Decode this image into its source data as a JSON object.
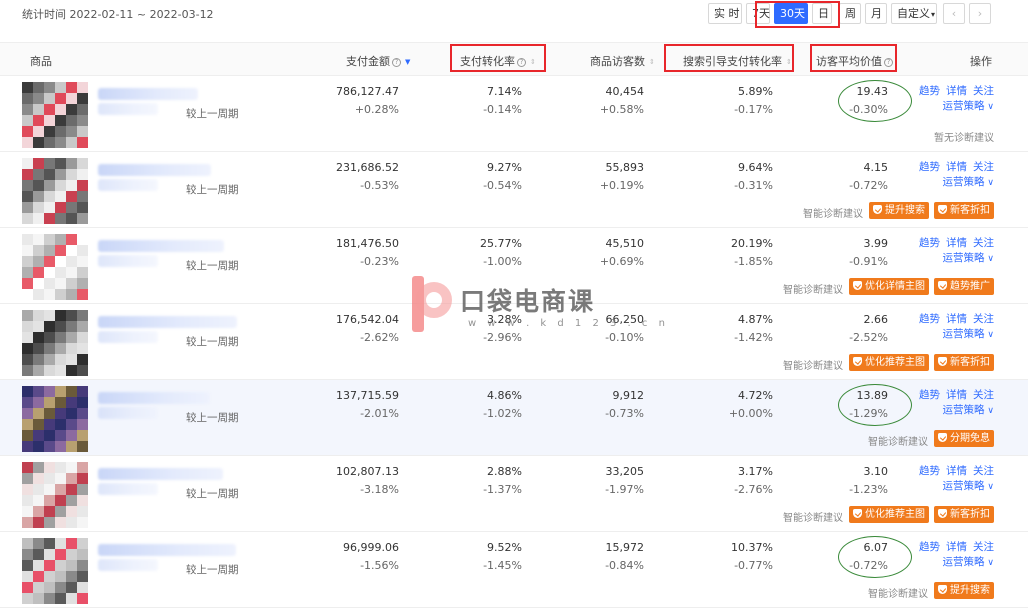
{
  "top": {
    "stat_time": "统计时间 2022-02-11 ~ 2022-03-12",
    "periods": [
      "实 时",
      "7天",
      "30天",
      "日",
      "周",
      "月",
      "自定义"
    ],
    "active_period": "30天",
    "custom_dropdown_icon": "chevron-down-icon",
    "prev_icon": "chevron-left-icon",
    "next_icon": "chevron-right-icon"
  },
  "columns": {
    "product": "商品",
    "pay_amount": "支付金额",
    "pay_conversion": "支付转化率",
    "visitors": "商品访客数",
    "search_conversion": "搜索引导支付转化率",
    "visitor_value": "访客平均价值",
    "action": "操作"
  },
  "labels": {
    "compare": "较上一周期",
    "trend": "趋势",
    "detail": "详情",
    "follow": "关注",
    "strategy": "运营策略",
    "smart_diag": "智能诊断建议",
    "no_diag": "暂无诊断建议"
  },
  "rows": [
    {
      "pay_amount": "786,127.47",
      "pay_amount_delta": "+0.28%",
      "pay_conversion": "7.14%",
      "pay_conversion_delta": "-0.14%",
      "visitors": "40,454",
      "visitors_delta": "+0.58%",
      "search_conversion": "5.89%",
      "search_conversion_delta": "-0.17%",
      "visitor_value": "19.43",
      "visitor_value_delta": "-0.30%",
      "tags": []
    },
    {
      "pay_amount": "231,686.52",
      "pay_amount_delta": "-0.53%",
      "pay_conversion": "9.27%",
      "pay_conversion_delta": "-0.54%",
      "visitors": "55,893",
      "visitors_delta": "+0.19%",
      "search_conversion": "9.64%",
      "search_conversion_delta": "-0.31%",
      "visitor_value": "4.15",
      "visitor_value_delta": "-0.72%",
      "tags": [
        "提升搜索",
        "新客折扣"
      ]
    },
    {
      "pay_amount": "181,476.50",
      "pay_amount_delta": "-0.23%",
      "pay_conversion": "25.77%",
      "pay_conversion_delta": "-1.00%",
      "visitors": "45,510",
      "visitors_delta": "+0.69%",
      "search_conversion": "20.19%",
      "search_conversion_delta": "-1.85%",
      "visitor_value": "3.99",
      "visitor_value_delta": "-0.91%",
      "tags": [
        "优化详情主图",
        "趋势推广"
      ]
    },
    {
      "pay_amount": "176,542.04",
      "pay_amount_delta": "-2.62%",
      "pay_conversion": "3.28%",
      "pay_conversion_delta": "-2.96%",
      "visitors": "66,250",
      "visitors_delta": "-0.10%",
      "search_conversion": "4.87%",
      "search_conversion_delta": "-1.42%",
      "visitor_value": "2.66",
      "visitor_value_delta": "-2.52%",
      "tags": [
        "优化推荐主图",
        "新客折扣"
      ]
    },
    {
      "pay_amount": "137,715.59",
      "pay_amount_delta": "-2.01%",
      "pay_conversion": "4.86%",
      "pay_conversion_delta": "-1.02%",
      "visitors": "9,912",
      "visitors_delta": "-0.73%",
      "search_conversion": "4.72%",
      "search_conversion_delta": "+0.00%",
      "visitor_value": "13.89",
      "visitor_value_delta": "-1.29%",
      "tags": [
        "分期免息"
      ]
    },
    {
      "pay_amount": "102,807.13",
      "pay_amount_delta": "-3.18%",
      "pay_conversion": "2.88%",
      "pay_conversion_delta": "-1.37%",
      "visitors": "33,205",
      "visitors_delta": "-1.97%",
      "search_conversion": "3.17%",
      "search_conversion_delta": "-2.76%",
      "visitor_value": "3.10",
      "visitor_value_delta": "-1.23%",
      "tags": [
        "优化推荐主图",
        "新客折扣"
      ]
    },
    {
      "pay_amount": "96,999.06",
      "pay_amount_delta": "-1.56%",
      "pay_conversion": "9.52%",
      "pay_conversion_delta": "-1.45%",
      "visitors": "15,972",
      "visitors_delta": "-0.84%",
      "search_conversion": "10.37%",
      "search_conversion_delta": "-0.77%",
      "visitor_value": "6.07",
      "visitor_value_delta": "-0.72%",
      "tags": [
        "提升搜索"
      ]
    }
  ],
  "watermark": {
    "text": "口袋电商课",
    "url": "w w w . k d 1 2 3 . c n"
  },
  "colors": {
    "accent": "#2f6bff",
    "tag": "#f07a1c",
    "annotation_red": "#e8262b",
    "annotation_green": "#3a8a3a"
  }
}
